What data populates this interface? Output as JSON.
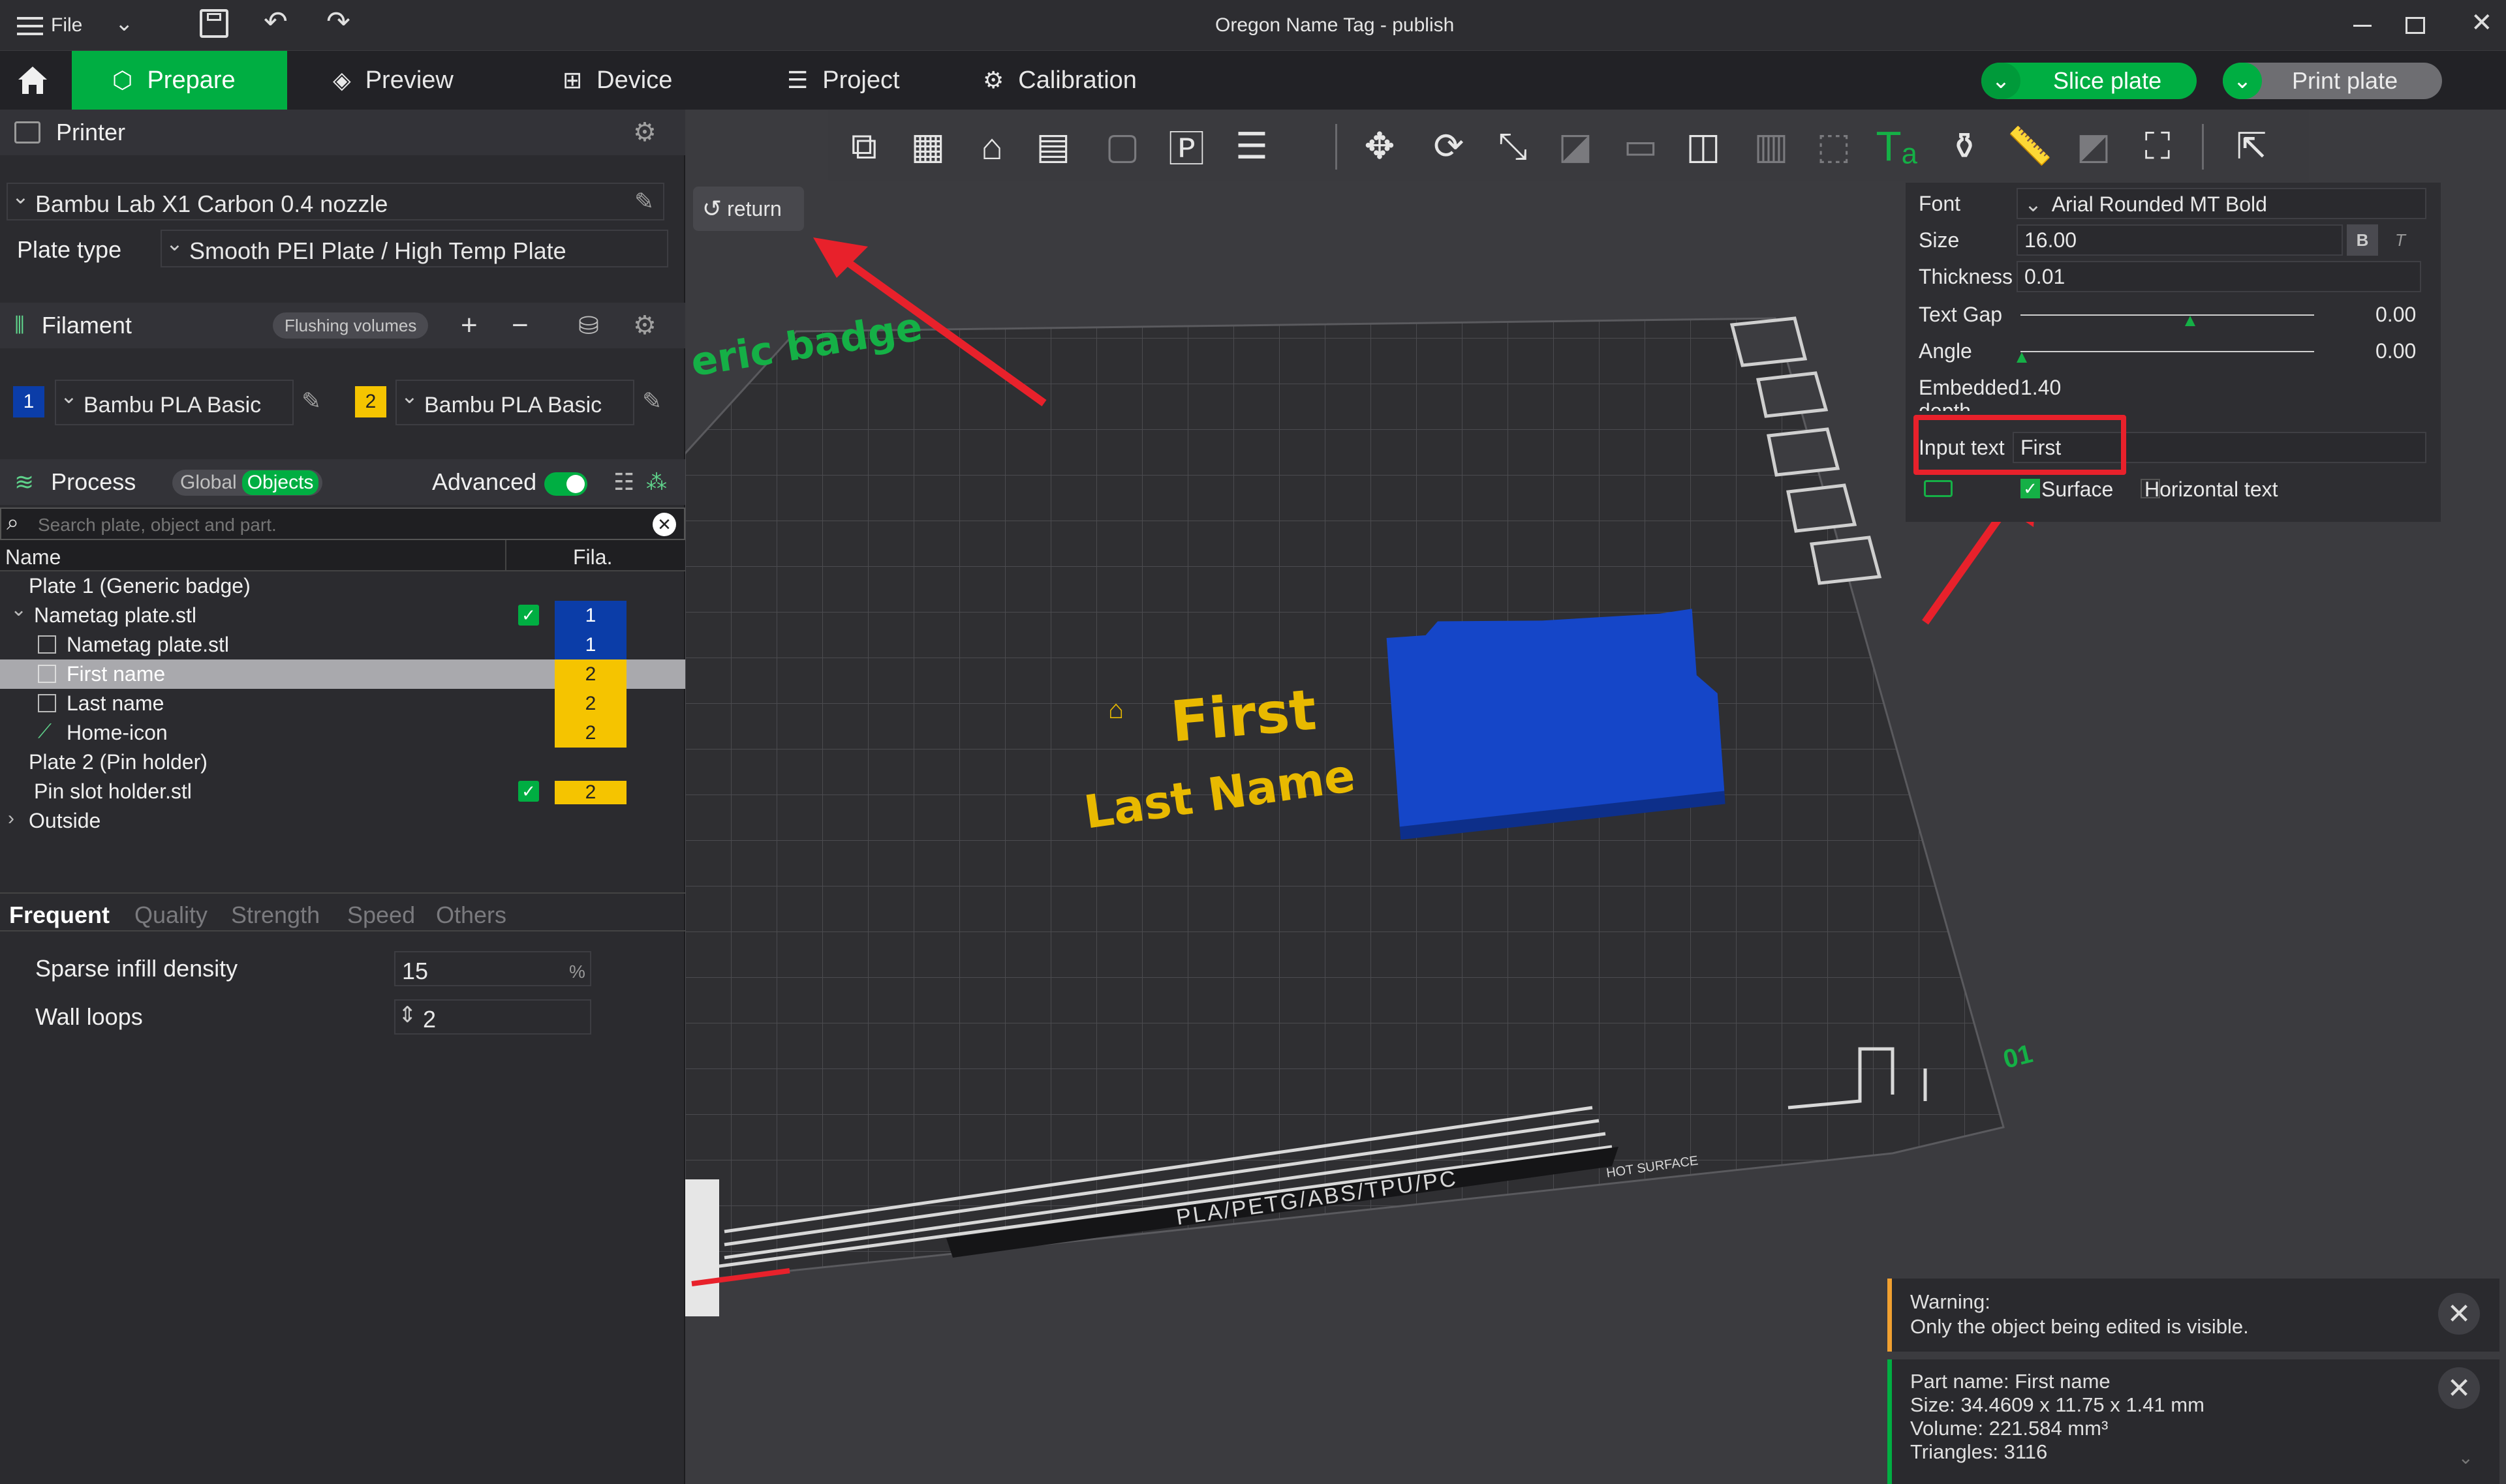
{
  "window": {
    "title": "Oregon Name Tag - publish",
    "file_menu": "File"
  },
  "tabs": {
    "prepare": "Prepare",
    "preview": "Preview",
    "device": "Device",
    "project": "Project",
    "calibration": "Calibration"
  },
  "actions": {
    "slice_plate": "Slice plate",
    "print_plate": "Print plate"
  },
  "printer": {
    "section_title": "Printer",
    "selected": "Bambu Lab X1 Carbon 0.4 nozzle",
    "plate_type_label": "Plate type",
    "plate_type_value": "Smooth PEI Plate / High Temp Plate"
  },
  "filament": {
    "section_title": "Filament",
    "flushing_volumes": "Flushing volumes",
    "items": [
      {
        "index": "1",
        "name": "Bambu PLA Basic",
        "color": "#0b3da8"
      },
      {
        "index": "2",
        "name": "Bambu PLA Basic",
        "color": "#f5c400"
      }
    ]
  },
  "process": {
    "section_title": "Process",
    "global_label": "Global",
    "objects_label": "Objects",
    "advanced_label": "Advanced",
    "advanced_on": true,
    "search_placeholder": "Search plate, object and part.",
    "columns": {
      "name": "Name",
      "fila": "Fila."
    },
    "tree": [
      {
        "label": "Plate 1 (Generic badge)",
        "fila": ""
      },
      {
        "label": "Nametag plate.stl",
        "fila": "1"
      },
      {
        "label": "Nametag plate.stl",
        "fila": "1"
      },
      {
        "label": "First name",
        "fila": "2",
        "selected": true
      },
      {
        "label": "Last name",
        "fila": "2"
      },
      {
        "label": "Home-icon",
        "fila": "2"
      },
      {
        "label": "Plate 2 (Pin holder)",
        "fila": ""
      },
      {
        "label": "Pin slot holder.stl",
        "fila": "2"
      },
      {
        "label": "Outside",
        "fila": ""
      }
    ],
    "setting_tabs": {
      "frequent": "Frequent",
      "quality": "Quality",
      "strength": "Strength",
      "speed": "Speed",
      "others": "Others"
    },
    "settings": {
      "sparse_infill_label": "Sparse infill density",
      "sparse_infill_value": "15",
      "sparse_infill_unit": "%",
      "wall_loops_label": "Wall loops",
      "wall_loops_value": "2"
    }
  },
  "viewport": {
    "return_label": "return",
    "plate_label": "eric badge",
    "plate_number": "01",
    "object_text_line1": "First",
    "object_text_line2": "Last Name",
    "plate_print_text": "PLA/PETG/ABS/TPU/PC",
    "hot_surface": "HOT SURFACE",
    "object_color": "#1040b8",
    "text_color": "#e8b900"
  },
  "text_panel": {
    "font_label": "Font",
    "font_value": "Arial Rounded MT Bold",
    "size_label": "Size",
    "size_value": "16.00",
    "bold": "B",
    "italic": "T",
    "thickness_label": "Thickness",
    "thickness_value": "0.01",
    "text_gap_label": "Text Gap",
    "text_gap_value": "0.00",
    "angle_label": "Angle",
    "angle_value": "0.00",
    "embedded_label": "Embedded",
    "embedded_label_2": "depth",
    "embedded_value": "1.40",
    "input_text_label": "Input text",
    "input_text_value": "First",
    "surface_label": "Surface",
    "horizontal_label": "Horizontal text"
  },
  "notifications": {
    "warning_title": "Warning:",
    "warning_body": "Only the object being edited is visible.",
    "part_name": "Part name: First name",
    "size": "Size: 34.4609 x 11.75 x 1.41 mm",
    "volume": "Volume: 221.584 mm³",
    "triangles": "Triangles: 3116"
  },
  "colors": {
    "accent": "#00ae42",
    "annotation_red": "#e8212b",
    "warning": "#f0a030"
  }
}
